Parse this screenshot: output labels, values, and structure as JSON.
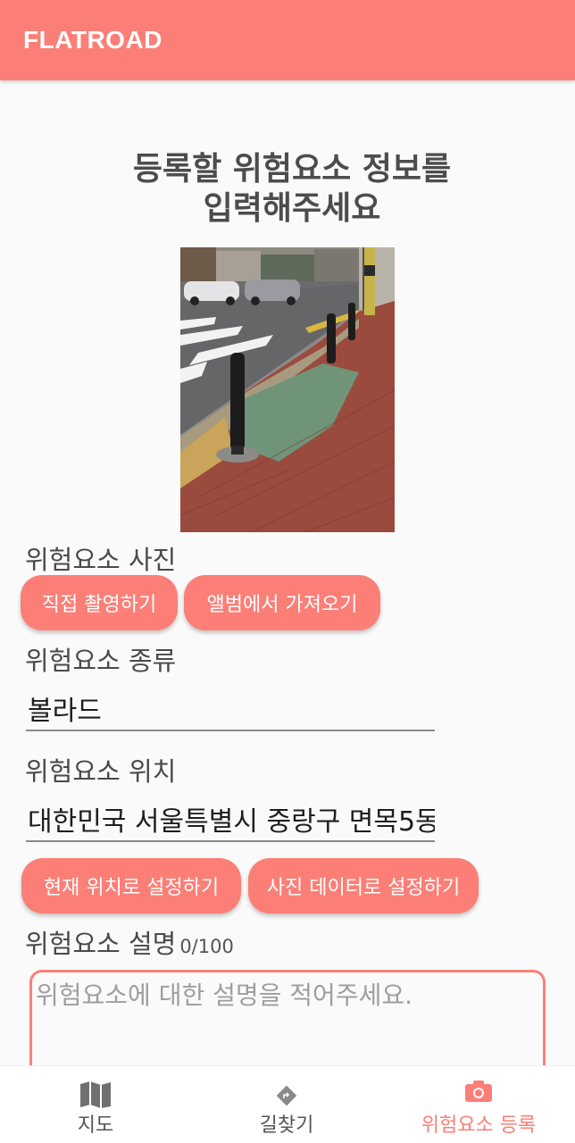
{
  "app": {
    "title": "FLATROAD"
  },
  "form": {
    "heading_line1": "등록할 위험요소 정보를",
    "heading_line2": "입력해주세요",
    "photo_label": "위험요소 사진",
    "take_photo_button": "직접 촬영하기",
    "album_button": "앨범에서 가져오기",
    "type_label": "위험요소 종류",
    "type_value": "볼라드",
    "location_label": "위험요소 위치",
    "location_value": "대한민국 서울특별시 중랑구 면목5동",
    "current_location_button": "현재 위치로 설정하기",
    "photo_data_button": "사진 데이터로 설정하기",
    "description_label": "위험요소 설명",
    "description_counter": "0/100",
    "description_placeholder": "위험요소에 대한 설명을 적어주세요.",
    "description_value": ""
  },
  "bottom_nav": {
    "items": [
      {
        "label": "지도",
        "icon": "map-icon",
        "active": false
      },
      {
        "label": "길찾기",
        "icon": "directions-icon",
        "active": false
      },
      {
        "label": "위험요소 등록",
        "icon": "camera-icon",
        "active": true
      }
    ]
  },
  "colors": {
    "accent": "#fb7f77",
    "background": "#fafafa",
    "text": "#4a4a4a",
    "inactive_icon": "#707070"
  }
}
